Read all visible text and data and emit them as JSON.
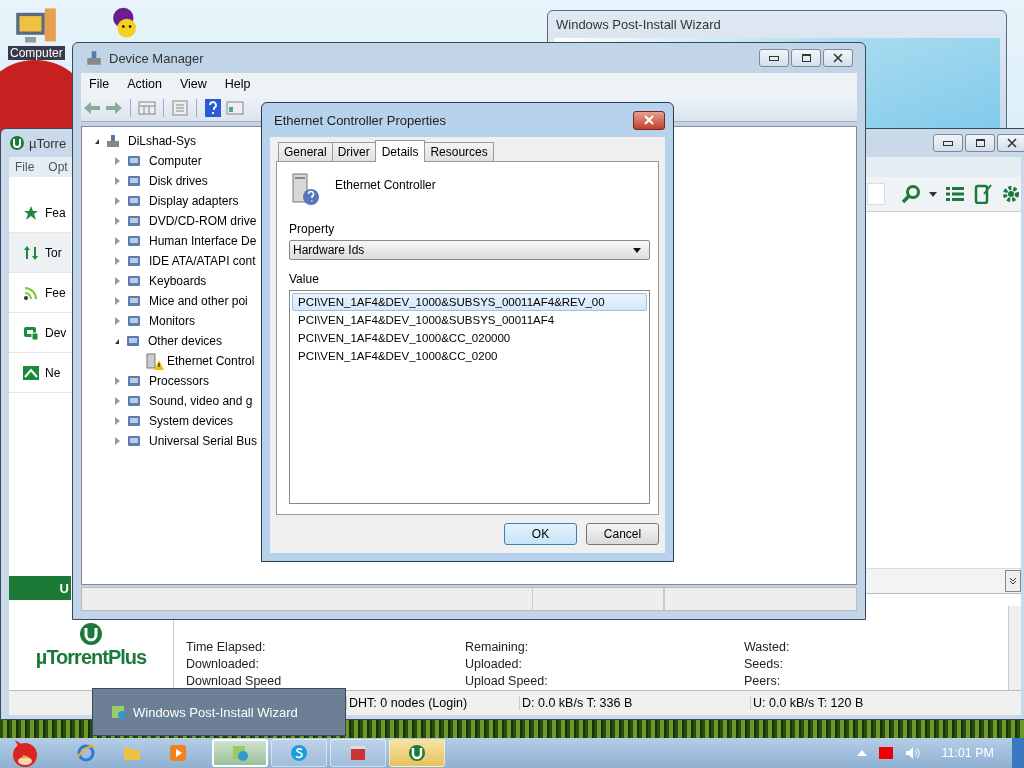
{
  "desktop_icons": [
    {
      "label": "Computer"
    }
  ],
  "wizard_window": {
    "title": "Windows Post-Install Wizard"
  },
  "utorrent": {
    "title": "µTorre",
    "menu": [
      "File",
      "Opt"
    ],
    "sidebar": [
      {
        "label": "Fea",
        "kind": "star",
        "selected": false
      },
      {
        "label": "Tor",
        "kind": "torrents",
        "selected": true
      },
      {
        "label": "Fee",
        "kind": "feed",
        "selected": false
      },
      {
        "label": "Dev",
        "kind": "device",
        "selected": false
      },
      {
        "label": "Ne",
        "kind": "news",
        "selected": false
      }
    ],
    "upgrade": "U",
    "logo": "µTorrentPlus",
    "transfer_fields": [
      [
        "Time Elapsed:",
        "Remaining:",
        "Wasted:"
      ],
      [
        "Downloaded:",
        "Uploaded:",
        "Seeds:"
      ],
      [
        "Download Speed",
        "Upload Speed:",
        "Peers:"
      ]
    ],
    "status": [
      "DHT: 0 nodes (Login)",
      "D: 0.0 kB/s T: 336 B",
      "U: 0.0 kB/s T: 120 B"
    ]
  },
  "device_manager": {
    "title": "Device Manager",
    "menu": [
      "File",
      "Action",
      "View",
      "Help"
    ],
    "tree": [
      {
        "label": "DiLshad-Sys",
        "expanded": true,
        "warning": false,
        "children": [
          {
            "label": "Computer",
            "expanded": false,
            "warning": false
          },
          {
            "label": "Disk drives",
            "expanded": false,
            "warning": false
          },
          {
            "label": "Display adapters",
            "expanded": false,
            "warning": false
          },
          {
            "label": "DVD/CD-ROM drive",
            "expanded": false,
            "warning": false
          },
          {
            "label": "Human Interface De",
            "expanded": false,
            "warning": false
          },
          {
            "label": "IDE ATA/ATAPI cont",
            "expanded": false,
            "warning": false
          },
          {
            "label": "Keyboards",
            "expanded": false,
            "warning": false
          },
          {
            "label": "Mice and other poi",
            "expanded": false,
            "warning": false
          },
          {
            "label": "Monitors",
            "expanded": false,
            "warning": false
          },
          {
            "label": "Other devices",
            "expanded": true,
            "warning": false,
            "children": [
              {
                "label": "Ethernet Control",
                "warning": true
              }
            ]
          },
          {
            "label": "Processors",
            "expanded": false,
            "warning": false
          },
          {
            "label": "Sound, video and g",
            "expanded": false,
            "warning": false
          },
          {
            "label": "System devices",
            "expanded": false,
            "warning": false
          },
          {
            "label": "Universal Serial Bus",
            "expanded": false,
            "warning": false
          }
        ]
      }
    ]
  },
  "dialog": {
    "title": "Ethernet Controller Properties",
    "tabs": [
      {
        "label": "General",
        "selected": false
      },
      {
        "label": "Driver",
        "selected": false
      },
      {
        "label": "Details",
        "selected": true
      },
      {
        "label": "Resources",
        "selected": false
      }
    ],
    "device_name": "Ethernet Controller",
    "property_label": "Property",
    "property_value": "Hardware Ids",
    "value_label": "Value",
    "values": [
      {
        "text": "PCI\\VEN_1AF4&DEV_1000&SUBSYS_00011AF4&REV_00",
        "selected": true
      },
      {
        "text": "PCI\\VEN_1AF4&DEV_1000&SUBSYS_00011AF4",
        "selected": false
      },
      {
        "text": "PCI\\VEN_1AF4&DEV_1000&CC_020000",
        "selected": false
      },
      {
        "text": "PCI\\VEN_1AF4&DEV_1000&CC_0200",
        "selected": false
      }
    ],
    "buttons": [
      "OK",
      "Cancel"
    ]
  },
  "taskbar_popup": {
    "label": "Windows Post-Install Wizard"
  },
  "taskbar": {
    "buttons": [
      {
        "kind": "wizard",
        "selected": true,
        "flashing": false
      },
      {
        "kind": "skype",
        "selected": false,
        "flashing": false
      },
      {
        "kind": "toolbox",
        "selected": false,
        "flashing": false
      },
      {
        "kind": "utorrent",
        "selected": false,
        "flashing": true
      }
    ],
    "clock": "11:01 PM"
  }
}
